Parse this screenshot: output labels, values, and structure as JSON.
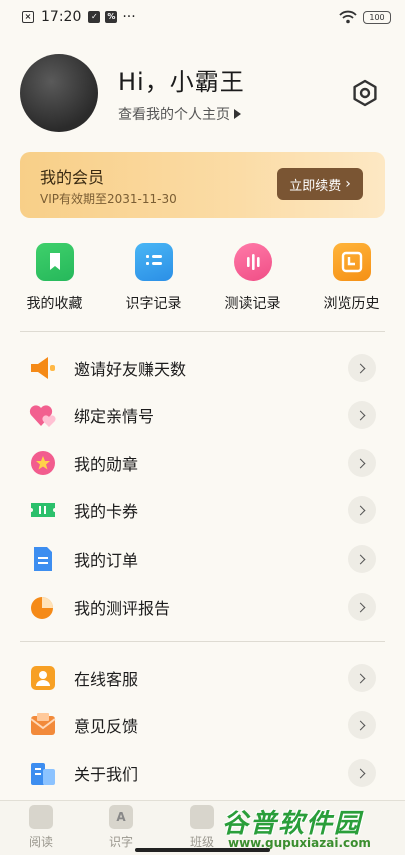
{
  "status_bar": {
    "time": "17:20",
    "left_icons": [
      "close-box-icon",
      "check-box-icon",
      "percent-box-icon"
    ],
    "more": "···",
    "battery": "100"
  },
  "profile": {
    "greeting": "Hi，小霸王",
    "home_link": "查看我的个人主页"
  },
  "vip": {
    "title": "我的会员",
    "expiry": "VIP有效期至2031-11-30",
    "renew_button": "立即续费"
  },
  "shortcuts": [
    {
      "label": "我的收藏",
      "icon": "bookmark-icon",
      "color": "#2bbd5f"
    },
    {
      "label": "识字记录",
      "icon": "list-icon",
      "color": "#3aa2ee"
    },
    {
      "label": "测读记录",
      "icon": "audio-wave-icon",
      "color": "#f25c8e"
    },
    {
      "label": "浏览历史",
      "icon": "clock-icon",
      "color": "#f7a024"
    }
  ],
  "menu_group_1": [
    {
      "label": "邀请好友赚天数",
      "icon": "megaphone-icon"
    },
    {
      "label": "绑定亲情号",
      "icon": "hearts-icon"
    },
    {
      "label": "我的勋章",
      "icon": "medal-icon"
    },
    {
      "label": "我的卡券",
      "icon": "ticket-icon"
    },
    {
      "label": "我的订单",
      "icon": "order-document-icon"
    },
    {
      "label": "我的测评报告",
      "icon": "pie-chart-icon"
    }
  ],
  "menu_group_2": [
    {
      "label": "在线客服",
      "icon": "customer-service-icon"
    },
    {
      "label": "意见反馈",
      "icon": "feedback-mail-icon"
    },
    {
      "label": "关于我们",
      "icon": "about-building-icon"
    }
  ],
  "tab_bar": [
    {
      "label": "阅读",
      "icon": "book-icon"
    },
    {
      "label": "识字",
      "icon": "letter-a-icon"
    },
    {
      "label": "班级",
      "icon": "class-icon"
    }
  ],
  "watermark": {
    "title": "谷普软件园",
    "url": "www.gupuxiazai.com"
  }
}
